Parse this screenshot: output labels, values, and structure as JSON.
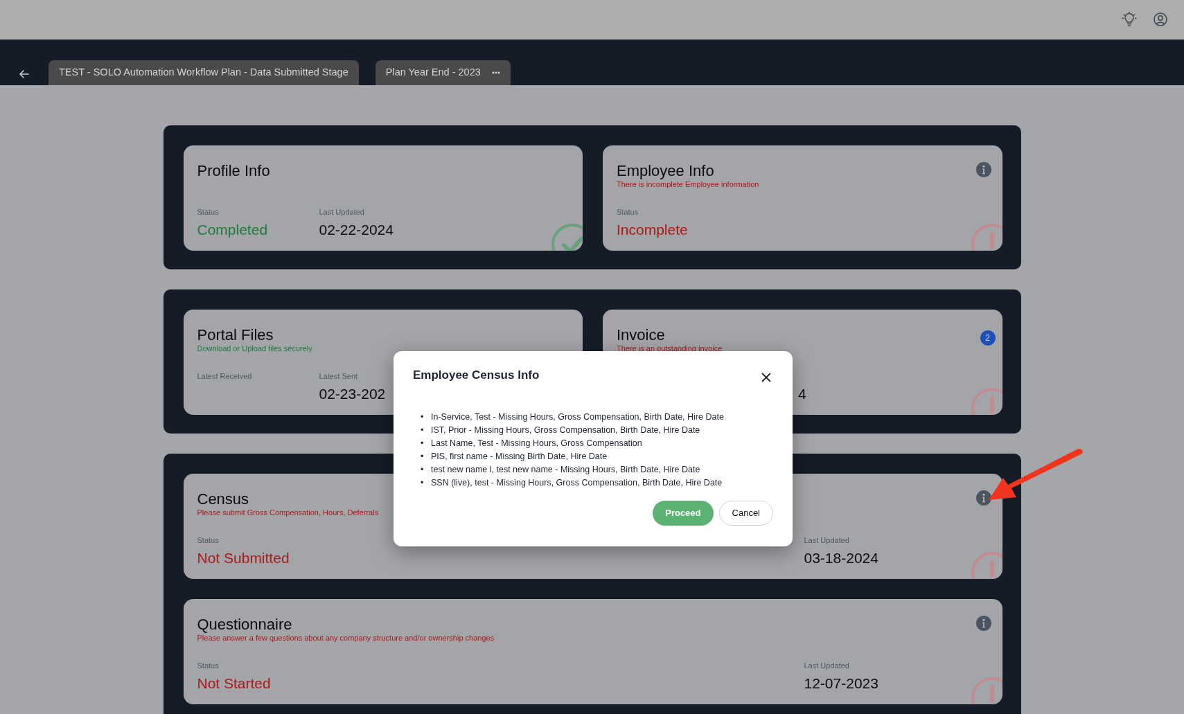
{
  "tabs": [
    {
      "label": "TEST - SOLO Automation Workflow Plan - Data Submitted Stage",
      "kind": "plain"
    },
    {
      "label": "Plan Year End - 2023",
      "kind": "menu"
    }
  ],
  "sections": [
    {
      "cards": [
        {
          "title": "Profile Info",
          "kind": "complete",
          "info": false,
          "fields": [
            {
              "label": "Status",
              "value": "Completed",
              "color": "#1d7a3a"
            },
            {
              "label": "Last Updated",
              "value": "02-22-2024",
              "color": "#0b0b0b"
            }
          ]
        },
        {
          "title": "Employee Info",
          "subtitle": {
            "text": "There is incomplete Employee information",
            "color": "#a8191c"
          },
          "kind": "incomplete",
          "info": true,
          "fields": [
            {
              "label": "Status",
              "value": "Incomplete",
              "color": "#a8191c"
            }
          ]
        }
      ]
    },
    {
      "cards": [
        {
          "title": "Portal Files",
          "subtitle": {
            "text": "Download or Upload files securely",
            "color": "#1d7a3a"
          },
          "kind": "files",
          "info": false,
          "fields": [
            {
              "label": "Latest Received"
            },
            {
              "label": "Latest Sent",
              "value": "02-23-202",
              "color": "#0b0b0b"
            }
          ]
        },
        {
          "title": "Invoice",
          "subtitle": {
            "text": "There is an outstanding invoice",
            "color": "#a8191c"
          },
          "badge": "2",
          "kind": "incomplete",
          "info": false,
          "fields": [
            {
              "value": "4",
              "color": "#0b0b0b"
            }
          ]
        }
      ]
    },
    {
      "cards": [
        {
          "title": "Census",
          "subtitle": {
            "text": "Please submit Gross Compensation, Hours, Deferrals",
            "color": "#a8191c"
          },
          "kind": "incomplete",
          "info": true,
          "fields": [
            {
              "label": "Status",
              "value": "Not Submitted",
              "color": "#a8191c"
            },
            {
              "label": "Last Updated",
              "value": "03-18-2024",
              "color": "#0b0b0b"
            }
          ]
        },
        {
          "title": "Questionnaire",
          "subtitle": {
            "text": "Please answer a few questions about any company structure and/or ownership changes",
            "color": "#a8191c"
          },
          "kind": "incomplete",
          "info": true,
          "fields": [
            {
              "label": "Status",
              "value": "Not Started",
              "color": "#a8191c"
            },
            {
              "label": "Last Updated",
              "value": "12-07-2023",
              "color": "#0b0b0b"
            }
          ]
        }
      ]
    }
  ],
  "modal": {
    "title": "Employee Census Info",
    "items": [
      {
        "bullet": "•",
        "text": "In-Service, Test - Missing Hours, Gross Compensation, Birth Date, Hire Date"
      },
      {
        "bullet": "•",
        "text": "IST, Prior - Missing Hours, Gross Compensation, Birth Date, Hire Date"
      },
      {
        "bullet": "•",
        "text": "Last Name, Test - Missing Hours, Gross Compensation"
      },
      {
        "bullet": "•",
        "text": "PIS, first name - Missing Birth Date, Hire Date"
      },
      {
        "bullet": "•",
        "text": "test new name l, test new name - Missing Hours, Birth Date, Hire Date"
      },
      {
        "bullet": "•",
        "text": "SSN (live), test - Missing Hours, Gross Compensation, Birth Date, Hire Date"
      }
    ],
    "buttons": [
      {
        "label": "Proceed",
        "kind": "primary"
      },
      {
        "label": "Cancel",
        "kind": "secondary"
      }
    ]
  }
}
